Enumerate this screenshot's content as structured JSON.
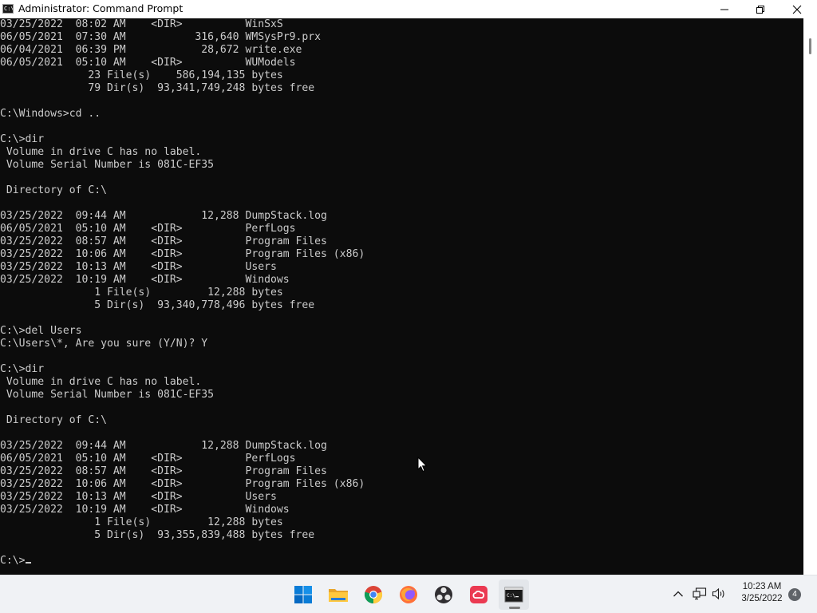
{
  "window": {
    "title": "Administrator: Command Prompt",
    "icon_text": "C:\\",
    "minimize_icon": "minimize-icon",
    "maximize_icon": "restore-icon",
    "close_icon": "close-icon"
  },
  "console": {
    "lines": [
      "03/25/2022  08:02 AM    <DIR>          WinSxS",
      "06/05/2021  07:30 AM           316,640 WMSysPr9.prx",
      "06/04/2021  06:39 PM            28,672 write.exe",
      "06/05/2021  05:10 AM    <DIR>          WUModels",
      "              23 File(s)    586,194,135 bytes",
      "              79 Dir(s)  93,341,749,248 bytes free",
      "",
      "C:\\Windows>cd ..",
      "",
      "C:\\>dir",
      " Volume in drive C has no label.",
      " Volume Serial Number is 081C-EF35",
      "",
      " Directory of C:\\",
      "",
      "03/25/2022  09:44 AM            12,288 DumpStack.log",
      "06/05/2021  05:10 AM    <DIR>          PerfLogs",
      "03/25/2022  08:57 AM    <DIR>          Program Files",
      "03/25/2022  10:06 AM    <DIR>          Program Files (x86)",
      "03/25/2022  10:13 AM    <DIR>          Users",
      "03/25/2022  10:19 AM    <DIR>          Windows",
      "               1 File(s)         12,288 bytes",
      "               5 Dir(s)  93,340,778,496 bytes free",
      "",
      "C:\\>del Users",
      "C:\\Users\\*, Are you sure (Y/N)? Y",
      "",
      "C:\\>dir",
      " Volume in drive C has no label.",
      " Volume Serial Number is 081C-EF35",
      "",
      " Directory of C:\\",
      "",
      "03/25/2022  09:44 AM            12,288 DumpStack.log",
      "06/05/2021  05:10 AM    <DIR>          PerfLogs",
      "03/25/2022  08:57 AM    <DIR>          Program Files",
      "03/25/2022  10:06 AM    <DIR>          Program Files (x86)",
      "03/25/2022  10:13 AM    <DIR>          Users",
      "03/25/2022  10:19 AM    <DIR>          Windows",
      "               1 File(s)         12,288 bytes",
      "               5 Dir(s)  93,355,839,488 bytes free",
      ""
    ],
    "prompt": "C:\\>",
    "text_color": "#cccccc",
    "background_color": "#0c0c0c"
  },
  "taskbar": {
    "apps": [
      {
        "name": "start",
        "icon": "windows-start-icon"
      },
      {
        "name": "file-explorer",
        "icon": "folder-icon"
      },
      {
        "name": "chrome",
        "icon": "chrome-icon"
      },
      {
        "name": "firefox",
        "icon": "firefox-icon"
      },
      {
        "name": "obs",
        "icon": "obs-icon"
      },
      {
        "name": "creative-cloud",
        "icon": "creative-cloud-icon"
      },
      {
        "name": "command-prompt",
        "icon": "terminal-icon",
        "active": true
      }
    ],
    "tray": {
      "chevron_icon": "chevron-up-icon",
      "network_icon": "network-icon",
      "volume_icon": "volume-icon"
    },
    "clock": {
      "time": "10:23 AM",
      "date": "3/25/2022"
    },
    "notification_count": "4"
  }
}
